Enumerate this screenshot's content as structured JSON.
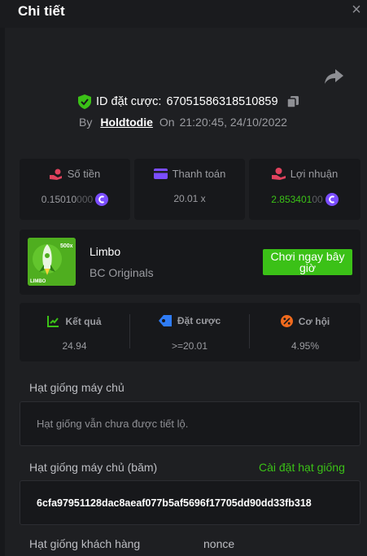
{
  "header": {
    "title": "Chi tiết",
    "close_icon": "×"
  },
  "bet": {
    "id_label": "ID đặt cược:",
    "id_value": "67051586318510859"
  },
  "byline": {
    "by": "By",
    "user": "Holdtodie",
    "on": "On",
    "datetime": "21:20:45, 24/10/2022"
  },
  "stats": [
    {
      "label": "Số tiền",
      "value_main": "0.15010",
      "value_dim": "000",
      "color": "#e0425d"
    },
    {
      "label": "Thanh toán",
      "value_main": "20.01 x",
      "value_dim": "",
      "color": "#7b4dff"
    },
    {
      "label": "Lợi nhuận",
      "value_main": "2.853401",
      "value_dim": "00",
      "color": "#e0425d"
    }
  ],
  "game": {
    "name": "Limbo",
    "provider": "BC Originals",
    "play_label": "Chơi ngay bây giờ",
    "thumb_badge": "500x",
    "thumb_label": "LIMBO"
  },
  "results": [
    {
      "label": "Kết quả",
      "value": "24.94",
      "color": "#3bc117"
    },
    {
      "label": "Đặt cược",
      "value": ">=20.01",
      "color": "#2f7cf6"
    },
    {
      "label": "Cơ hội",
      "value": "4.95%",
      "color": "#f06a1d"
    }
  ],
  "server_seed": {
    "label": "Hạt giống máy chủ",
    "placeholder": "Hạt giống vẫn chưa được tiết lộ."
  },
  "hashed_seed": {
    "label": "Hạt giống máy chủ (băm)",
    "link": "Cài đặt hạt giống",
    "value": "6cfa97951128dac8aeaf077b5af5696f17705dd90dd33fb318"
  },
  "client_seed": {
    "label": "Hạt giống khách hàng",
    "nonce_label": "nonce"
  },
  "colors": {
    "accent_green": "#3bc117",
    "background": "#1e1f22",
    "card": "#17181b"
  }
}
